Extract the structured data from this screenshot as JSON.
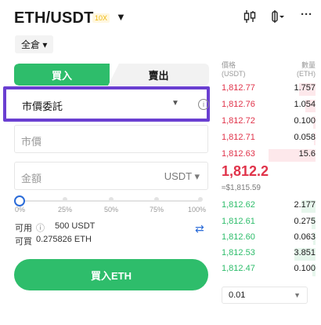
{
  "header": {
    "pair": "ETH/USDT",
    "leverage": "10X",
    "pair_caret": "▼",
    "chart_icon": "⫶",
    "order_icon": "⫯",
    "more_icon": "···"
  },
  "margin_mode": "全倉 ▾",
  "tabs": {
    "buy": "買入",
    "sell": "賣出"
  },
  "order_type": {
    "label": "市價委託",
    "caret": "▼",
    "info": "i"
  },
  "price_field": {
    "placeholder": "市價"
  },
  "amount_field": {
    "placeholder": "金額",
    "unit": "USDT ▾"
  },
  "slider": {
    "value_percent": 0,
    "ticks": [
      "0%",
      "25%",
      "50%",
      "75%",
      "100%"
    ]
  },
  "available": {
    "label": "可用",
    "info": "ⓘ",
    "value": "500 USDT"
  },
  "buyable": {
    "label": "可買",
    "value": "0.275826 ETH"
  },
  "swap_icon": "⇄",
  "buy_button": "買入ETH",
  "orderbook": {
    "price_header": [
      "價格",
      "(USDT)"
    ],
    "qty_header": [
      "數量",
      "(ETH)"
    ],
    "asks": [
      {
        "price": "1,812.77",
        "qty": "1.757",
        "depth": 0.35
      },
      {
        "price": "1,812.76",
        "qty": "1.054",
        "depth": 0.22
      },
      {
        "price": "1,812.72",
        "qty": "0.100",
        "depth": 0.05
      },
      {
        "price": "1,812.71",
        "qty": "0.058",
        "depth": 0.04
      },
      {
        "price": "1,812.63",
        "qty": "15.6",
        "depth": 1.0
      }
    ],
    "last_price": "1,812.2",
    "mark_price": "≈$1,815.59",
    "bids": [
      {
        "price": "1,812.62",
        "qty": "2.177",
        "depth": 0.3
      },
      {
        "price": "1,812.61",
        "qty": "0.275",
        "depth": 0.08
      },
      {
        "price": "1,812.60",
        "qty": "0.063",
        "depth": 0.05
      },
      {
        "price": "1,812.53",
        "qty": "3.851",
        "depth": 0.45
      },
      {
        "price": "1,812.47",
        "qty": "0.100",
        "depth": 0.06
      }
    ],
    "depth_value": "0.01",
    "depth_caret": "▼"
  },
  "colors": {
    "buy": "#2ebd6b",
    "sell": "#e0334a",
    "highlight": "#6a3fd1",
    "accent": "#2a6bd8"
  }
}
